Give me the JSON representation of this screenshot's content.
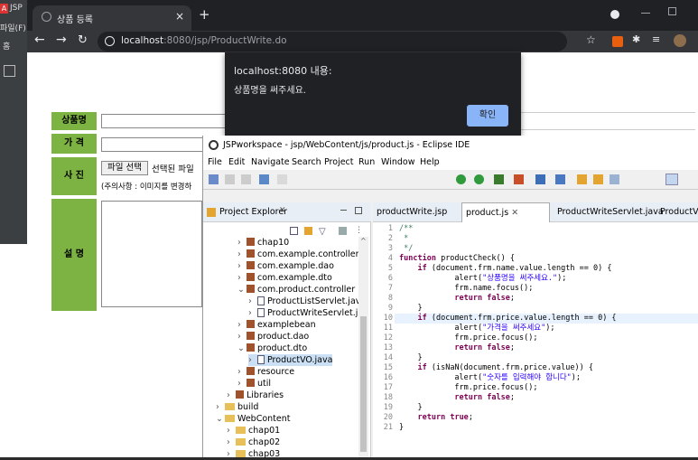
{
  "back_window": {
    "red_badge": "A",
    "app_label": "JSP",
    "menu_file": "파일(F)",
    "menu_home": "홈"
  },
  "browser": {
    "tab_title": "상품 등록",
    "url_host": "localhost",
    "url_path": ":8080/jsp/ProductWrite.do"
  },
  "form": {
    "labels": [
      "상품명",
      "가 격",
      "사 진",
      "설 명"
    ],
    "file_button": "파일 선택",
    "file_status": "선택된 파일",
    "notice": "(주의사항 : 이미지를 변경하"
  },
  "alert": {
    "title": "localhost:8080 내용:",
    "message": "상품명을 써주세요.",
    "ok": "확인"
  },
  "eclipse": {
    "title": "JSPworkspace - jsp/WebContent/js/product.js - Eclipse IDE",
    "menu": [
      "File",
      "Edit",
      "Navigate",
      "Search",
      "Project",
      "Run",
      "Window",
      "Help"
    ],
    "explorer_title": "Project Explorer",
    "tree": [
      {
        "label": "chap10",
        "icon": "package",
        "indent": 2,
        "arrow": ">"
      },
      {
        "label": "com.example.controller",
        "icon": "package",
        "indent": 2,
        "arrow": ">"
      },
      {
        "label": "com.example.dao",
        "icon": "package",
        "indent": 2,
        "arrow": ">"
      },
      {
        "label": "com.example.dto",
        "icon": "package",
        "indent": 2,
        "arrow": ">"
      },
      {
        "label": "com.product.controller",
        "icon": "package",
        "indent": 2,
        "arrow": "v"
      },
      {
        "label": "ProductListServlet.java",
        "icon": "java",
        "indent": 3,
        "arrow": ">"
      },
      {
        "label": "ProductWriteServlet.jav",
        "icon": "java",
        "indent": 3,
        "arrow": ">"
      },
      {
        "label": "examplebean",
        "icon": "package",
        "indent": 2,
        "arrow": ">"
      },
      {
        "label": "product.dao",
        "icon": "package",
        "indent": 2,
        "arrow": ">"
      },
      {
        "label": "product.dto",
        "icon": "package",
        "indent": 2,
        "arrow": "v"
      },
      {
        "label": "ProductVO.java",
        "icon": "java",
        "indent": 3,
        "arrow": ">",
        "selected": true
      },
      {
        "label": "resource",
        "icon": "package",
        "indent": 2,
        "arrow": ">"
      },
      {
        "label": "util",
        "icon": "package",
        "indent": 2,
        "arrow": ">"
      },
      {
        "label": "Libraries",
        "icon": "library",
        "indent": 1,
        "arrow": ">"
      },
      {
        "label": "build",
        "icon": "folder",
        "indent": 0,
        "arrow": ">"
      },
      {
        "label": "WebContent",
        "icon": "folder",
        "indent": 0,
        "arrow": "v"
      },
      {
        "label": "chap01",
        "icon": "folder",
        "indent": 1,
        "arrow": ">"
      },
      {
        "label": "chap02",
        "icon": "folder",
        "indent": 1,
        "arrow": ">"
      },
      {
        "label": "chap03",
        "icon": "folder",
        "indent": 1,
        "arrow": ">"
      }
    ],
    "editor_tabs": [
      "productWrite.jsp",
      "product.js",
      "ProductWriteServlet.java",
      "ProductV"
    ],
    "active_tab": 1,
    "highlight_line": 10,
    "code": [
      {
        "n": "1",
        "t": "/**"
      },
      {
        "n": "2",
        "t": " *"
      },
      {
        "n": "3",
        "t": " */"
      },
      {
        "n": "4",
        "t": "function productCheck() {"
      },
      {
        "n": "5",
        "t": "    if (document.frm.name.value.length == 0) {"
      },
      {
        "n": "6",
        "t": "            alert(\"상품명을 써주세요.\");"
      },
      {
        "n": "7",
        "t": "            frm.name.focus();"
      },
      {
        "n": "8",
        "t": "            return false;"
      },
      {
        "n": "9",
        "t": "    }"
      },
      {
        "n": "10",
        "t": "    if (document.frm.price.value.length == 0) {"
      },
      {
        "n": "11",
        "t": "            alert(\"가격을 써주세요\");"
      },
      {
        "n": "12",
        "t": "            frm.price.focus();"
      },
      {
        "n": "13",
        "t": "            return false;"
      },
      {
        "n": "14",
        "t": "    }"
      },
      {
        "n": "15",
        "t": "    if (isNaN(document.frm.price.value)) {"
      },
      {
        "n": "16",
        "t": "            alert(\"숫자를 입력해야 합니다\");"
      },
      {
        "n": "17",
        "t": "            frm.price.focus();"
      },
      {
        "n": "18",
        "t": "            return false;"
      },
      {
        "n": "19",
        "t": "    }"
      },
      {
        "n": "20",
        "t": "    return true;"
      },
      {
        "n": "21",
        "t": "}"
      }
    ]
  },
  "colors": {
    "form_label_bg": "#7cb342",
    "alert_bg": "#202124",
    "ok_button": "#8ab4f8",
    "highlight": "#e8f2fe"
  }
}
